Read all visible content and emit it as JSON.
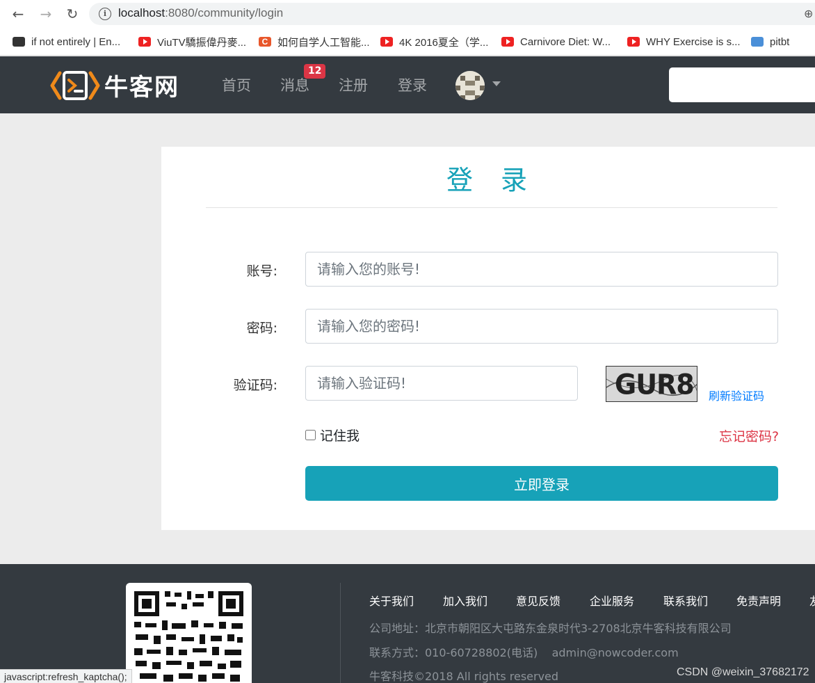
{
  "browser": {
    "url_host": "localhost",
    "url_rest": ":8080/community/login",
    "bookmarks": [
      {
        "icon": "keyboard-icon",
        "label": "if not entirely | En..."
      },
      {
        "icon": "youtube-icon",
        "label": "ViuTV驕振偉丹麥..."
      },
      {
        "icon": "c-icon",
        "label": "如何自学人工智能..."
      },
      {
        "icon": "youtube-icon",
        "label": "4K 2016夏全（学..."
      },
      {
        "icon": "youtube-icon",
        "label": "Carnivore Diet: W..."
      },
      {
        "icon": "youtube-icon",
        "label": "WHY Exercise is s..."
      },
      {
        "icon": "pitbt-icon",
        "label": "pitbt"
      }
    ],
    "status_text": "javascript:refresh_kaptcha();"
  },
  "header": {
    "logo_text": "牛客网",
    "nav": [
      "首页",
      "消息",
      "注册",
      "登录"
    ],
    "message_badge": "12"
  },
  "login": {
    "title": "登 录",
    "account_label": "账号:",
    "account_placeholder": "请输入您的账号!",
    "password_label": "密码:",
    "password_placeholder": "请输入您的密码!",
    "captcha_label": "验证码:",
    "captcha_placeholder": "请输入验证码!",
    "captcha_image_text": "GUR8",
    "refresh_captcha": "刷新验证码",
    "remember_me": "记住我",
    "forgot_password": "忘记密码?",
    "submit": "立即登录"
  },
  "footer": {
    "links": [
      "关于我们",
      "加入我们",
      "意见反馈",
      "企业服务",
      "联系我们",
      "免责声明",
      "友"
    ],
    "address": "公司地址：北京市朝阳区大屯路东金泉时代3-2708北京牛客科技有限公司",
    "contact": "联系方式：010-60728802(电话)    admin@nowcoder.com",
    "copyright": "牛客科技©2018 All rights reserved",
    "watermark": "CSDN @weixin_37682172"
  },
  "colors": {
    "header_bg": "#343a40",
    "accent": "#17a2b8",
    "danger": "#dc3545",
    "link": "#007bff"
  }
}
